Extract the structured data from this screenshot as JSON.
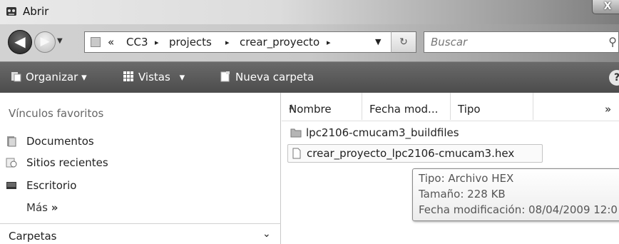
{
  "window": {
    "title": "Abrir",
    "close_glyph": "X"
  },
  "address": {
    "overflow": "«",
    "crumbs": [
      "CC3",
      "projects",
      "crear_proyecto"
    ],
    "separator": "▸"
  },
  "search": {
    "placeholder": "Buscar"
  },
  "toolbar": {
    "organize": "Organizar",
    "views": "Vistas",
    "new_folder": "Nueva carpeta",
    "dropdown_glyph": "▾",
    "help_glyph": "?"
  },
  "sidebar": {
    "favorites_heading": "Vínculos favoritos",
    "items": [
      {
        "label": "Documentos",
        "icon": "documents-icon"
      },
      {
        "label": "Sitios recientes",
        "icon": "recent-places-icon"
      },
      {
        "label": "Escritorio",
        "icon": "desktop-icon"
      }
    ],
    "more": "Más",
    "more_glyph": "»",
    "folders_label": "Carpetas",
    "folders_chevron": "⌄"
  },
  "file_list": {
    "columns": [
      "Nombre",
      "Fecha mod...",
      "Tipo"
    ],
    "overflow_glyph": "»",
    "rows": [
      {
        "name": "lpc2106-cmucam3_buildfiles",
        "icon": "folder-icon"
      },
      {
        "name": "crear_proyecto_lpc2106-cmucam3.hex",
        "icon": "file-icon"
      }
    ]
  },
  "tooltip": {
    "type_line": "Tipo: Archivo HEX",
    "size_line": "Tamaño: 228 KB",
    "date_line": "Fecha modificación: 08/04/2009 12:0"
  }
}
